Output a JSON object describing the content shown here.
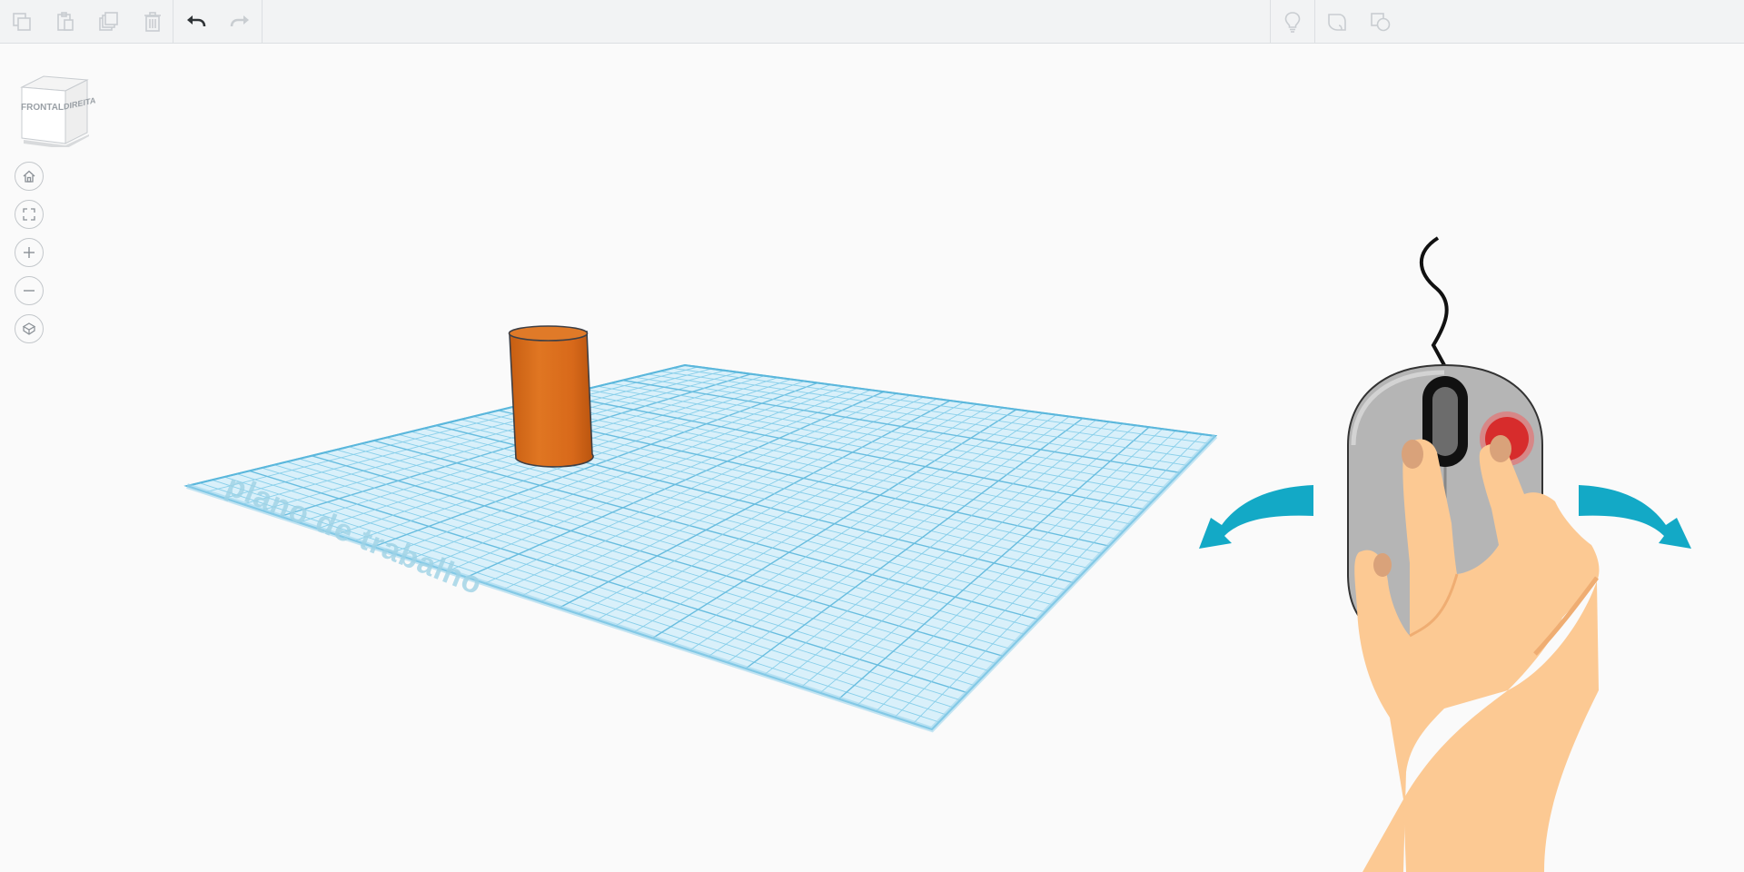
{
  "toolbar": {
    "left_buttons": [
      {
        "name": "copy",
        "icon": "copy-icon",
        "enabled": false
      },
      {
        "name": "paste",
        "icon": "paste-icon",
        "enabled": false
      },
      {
        "name": "duplicate",
        "icon": "duplicate-icon",
        "enabled": false
      },
      {
        "name": "delete",
        "icon": "trash-icon",
        "enabled": false
      },
      {
        "name": "undo",
        "icon": "undo-icon",
        "enabled": true
      },
      {
        "name": "redo",
        "icon": "redo-icon",
        "enabled": false
      }
    ],
    "right_buttons": [
      {
        "name": "hint",
        "icon": "lightbulb-icon"
      },
      {
        "name": "notes",
        "icon": "note-icon"
      },
      {
        "name": "shapes",
        "icon": "shapes-icon"
      }
    ]
  },
  "view_cube": {
    "front_label": "FRONTAL",
    "right_label": "DIREITA"
  },
  "nav": [
    "home-icon",
    "fit-view-icon",
    "zoom-in-icon",
    "zoom-out-icon",
    "perspective-icon"
  ],
  "workplane": {
    "label": "plano de trabalho",
    "grid_color": "#6cc3e3",
    "fill_color": "#d6eef8"
  },
  "shape": {
    "type": "cylinder",
    "color": "#d96a1a"
  },
  "hint_illustration": {
    "description_icon": "mouse-right-drag-orbit-icon",
    "arrow_color": "#13a9c6",
    "button_color": "#d72c2c"
  },
  "colors": {
    "background": "#fafafa",
    "toolbar": "#f2f3f4"
  }
}
